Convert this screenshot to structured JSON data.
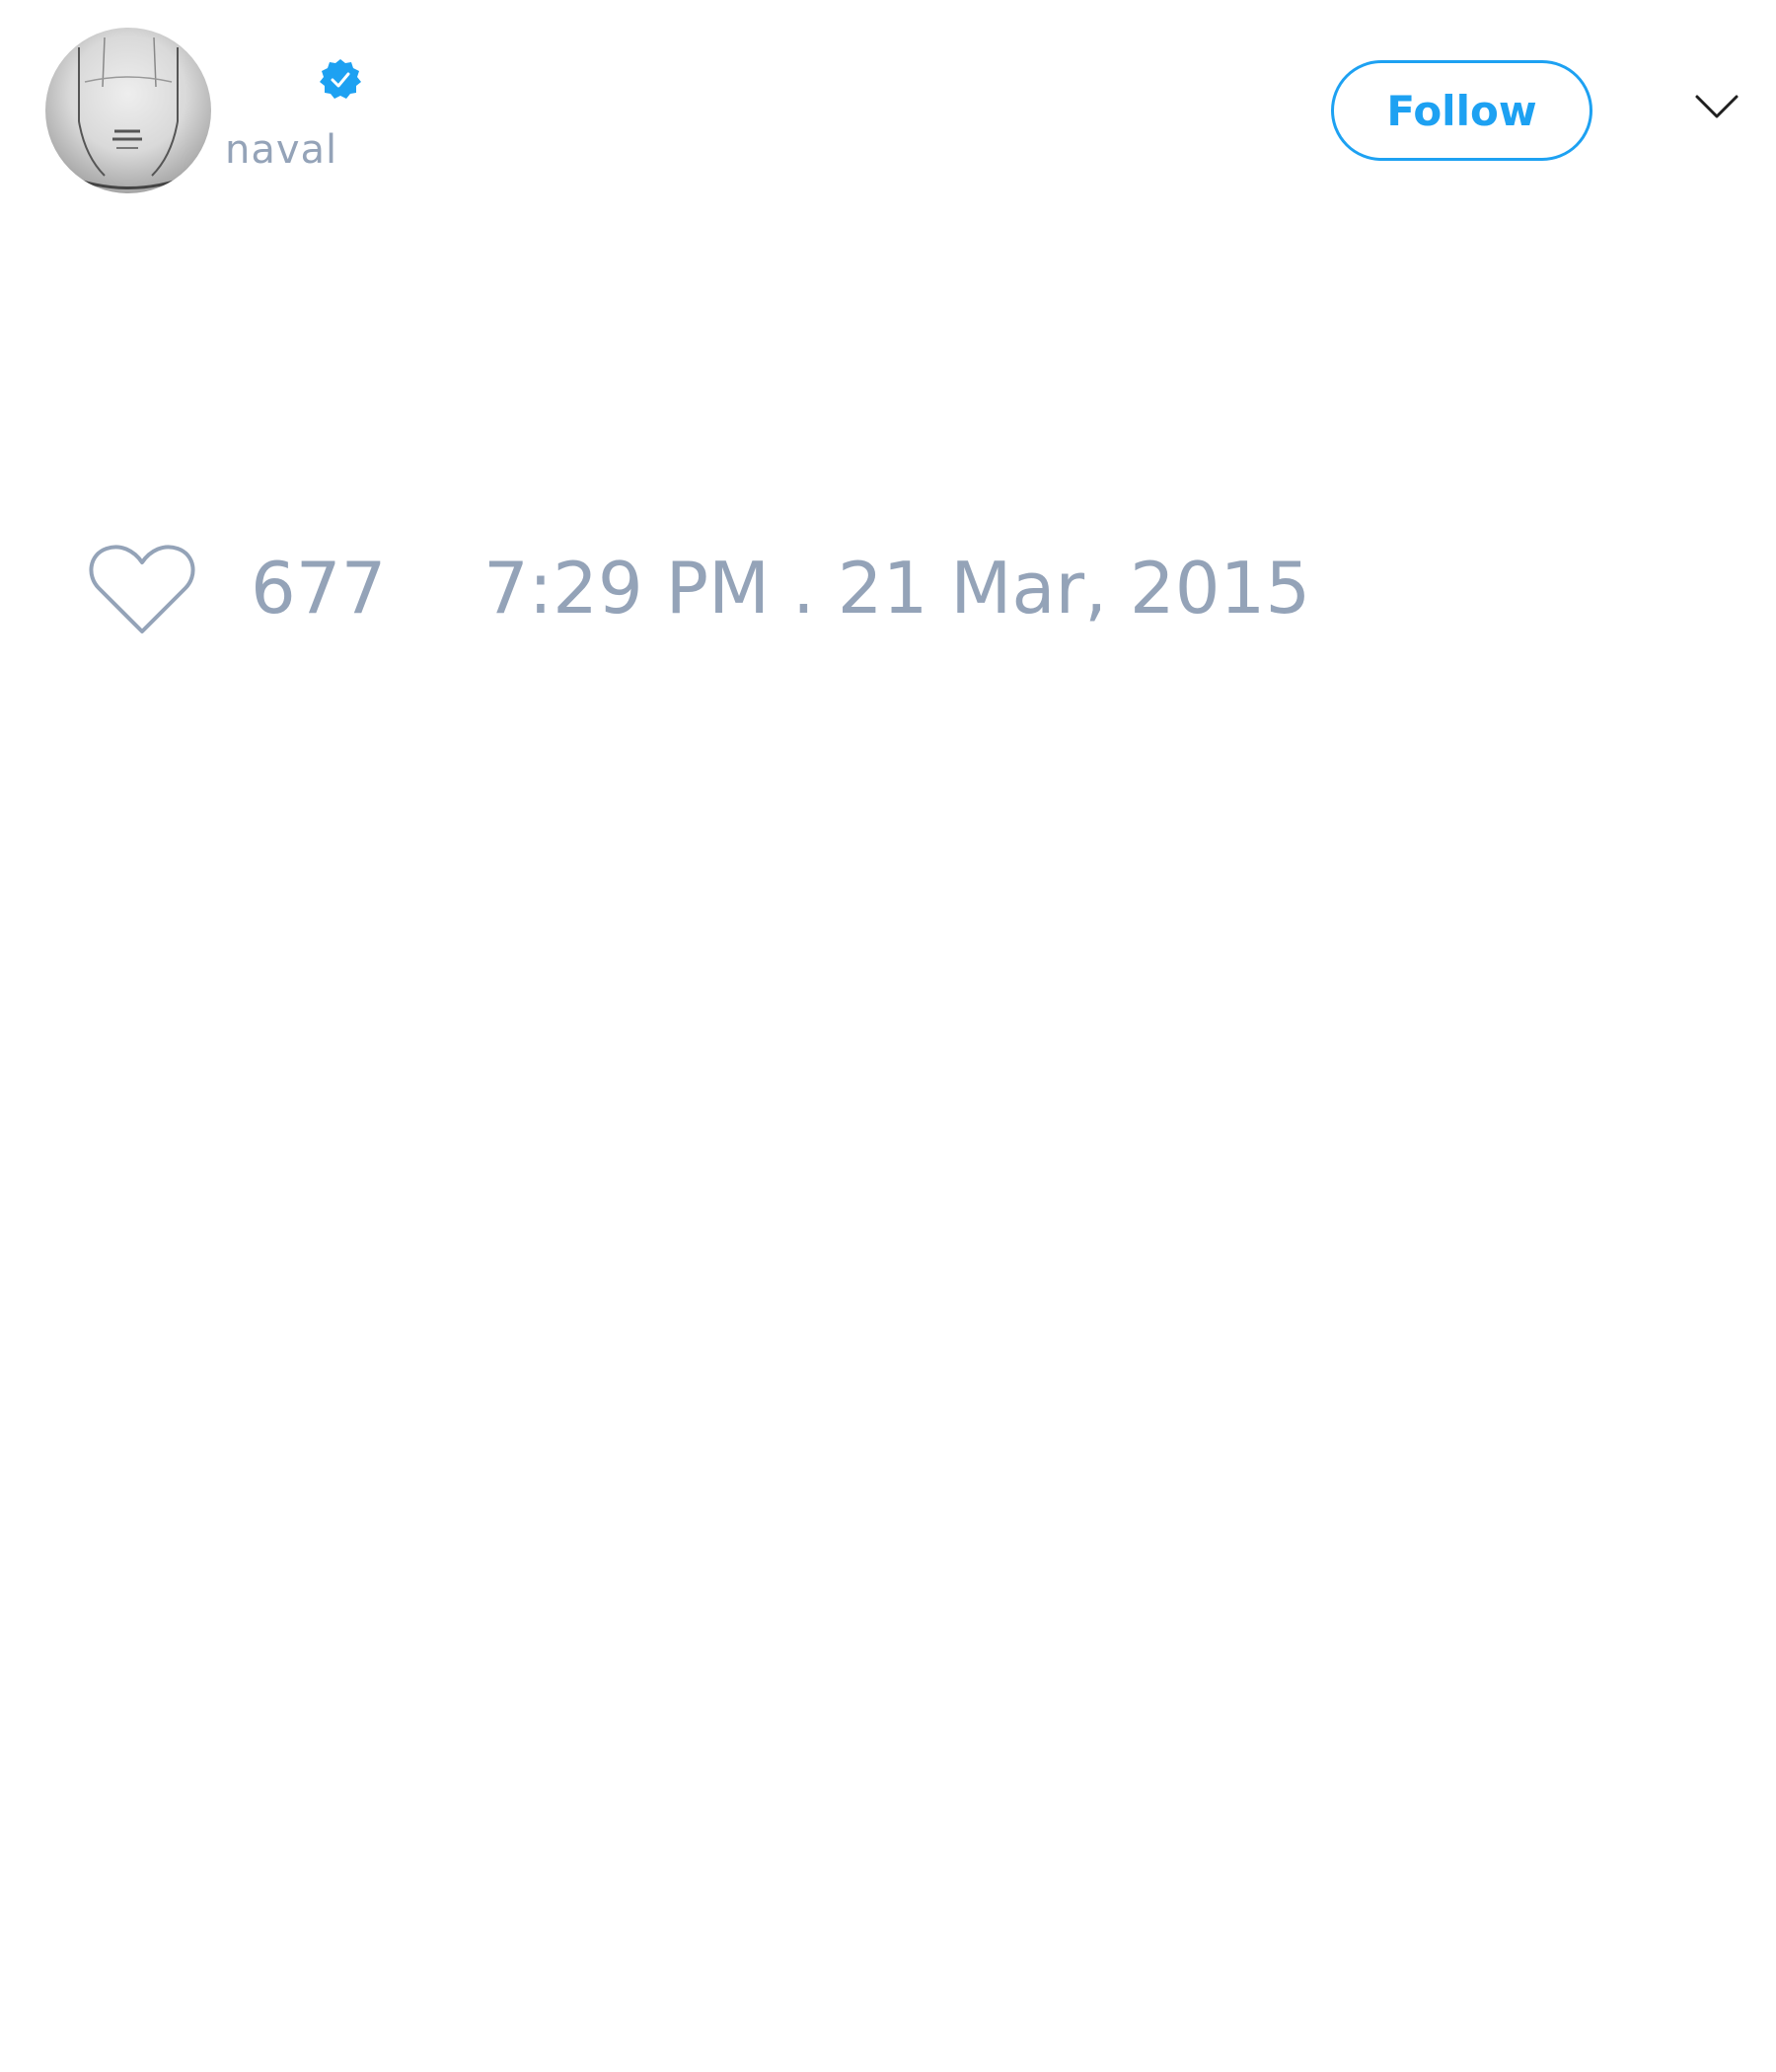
{
  "tweet": {
    "author": {
      "handle": "naval",
      "verified": true,
      "avatar": "profile-photo"
    },
    "follow_label": "Follow",
    "menu_icon": "chevron-down-icon",
    "likes": "677",
    "like_icon": "heart-outline-icon",
    "timestamp": "7:29 PM . 21 Mar, 2015"
  },
  "colors": {
    "accent": "#1da1f2",
    "muted_text": "#94a3b8",
    "background": "#ffffff"
  }
}
